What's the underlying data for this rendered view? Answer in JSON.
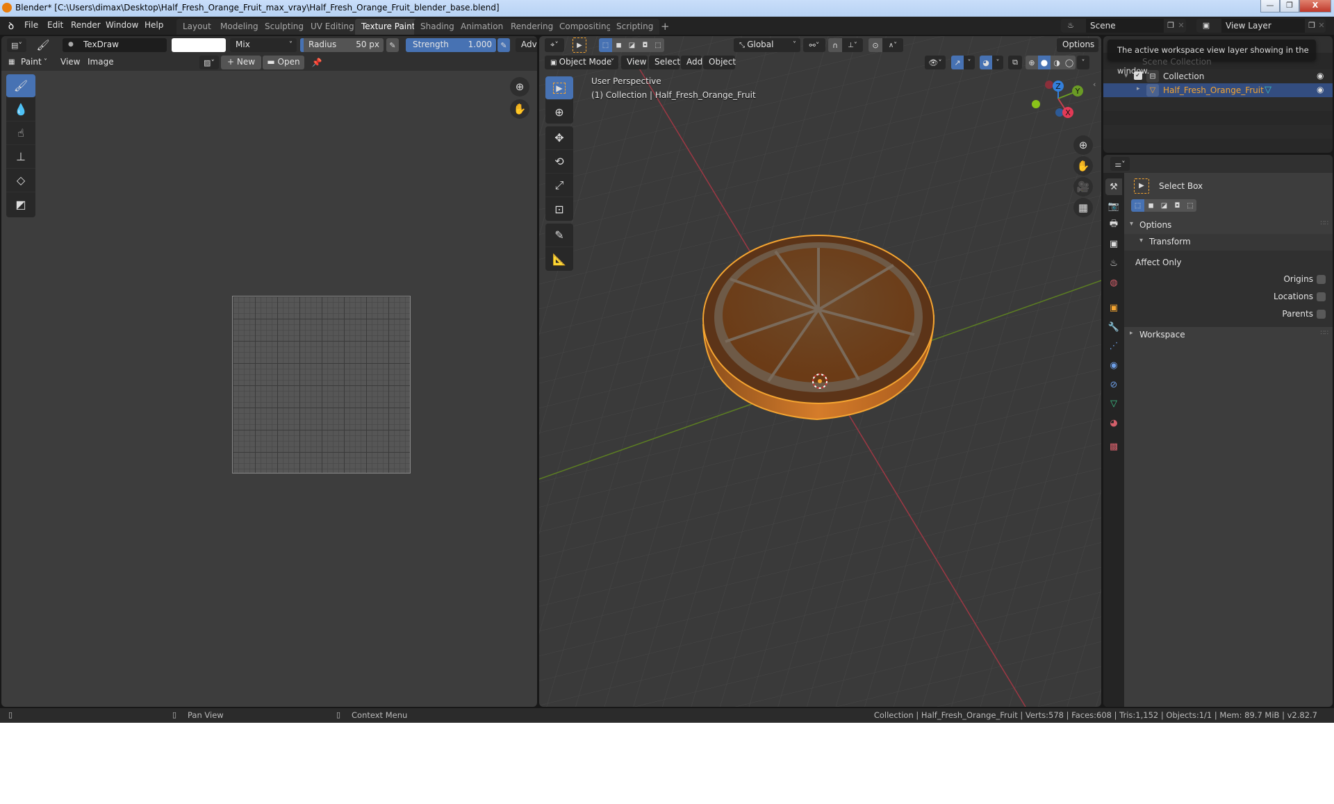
{
  "window": {
    "title": "Blender* [C:\\Users\\dimax\\Desktop\\Half_Fresh_Orange_Fruit_max_vray\\Half_Fresh_Orange_Fruit_blender_base.blend]",
    "minimize": "—",
    "maximize": "❐",
    "close": "X"
  },
  "menubar": {
    "items": [
      "File",
      "Edit",
      "Render",
      "Window",
      "Help"
    ]
  },
  "workspaces": {
    "tabs": [
      "Layout",
      "Modeling",
      "Sculpting",
      "UV Editing",
      "Texture Paint",
      "Shading",
      "Animation",
      "Rendering",
      "Compositing",
      "Scripting"
    ],
    "active": "Texture Paint",
    "add": "+"
  },
  "scene": {
    "name": "Scene"
  },
  "view_layer": {
    "name": "View Layer"
  },
  "tooltip": "The active workspace view layer showing in the window.",
  "image_editor": {
    "brush_name": "TexDraw",
    "blend_mode": "Mix",
    "radius_label": "Radius",
    "radius_value": "50 px",
    "strength_label": "Strength",
    "strength_value": "1.000",
    "advanced_label": "Adva",
    "mode": "Paint",
    "menu": [
      "View",
      "Image"
    ],
    "new_label": "New",
    "open_label": "Open",
    "brush_color": "#ffffff",
    "tools": [
      "draw",
      "soften",
      "smear",
      "clone",
      "fill",
      "mask"
    ]
  },
  "viewport": {
    "mode": "Object Mode",
    "menu": [
      "View",
      "Select",
      "Add",
      "Object"
    ],
    "orientation": "Global",
    "options_label": "Options",
    "overlay_title": "User Perspective",
    "overlay_subtitle": "(1) Collection | Half_Fresh_Orange_Fruit",
    "gizmo": {
      "x": "X",
      "y": "Y",
      "z": "Z"
    }
  },
  "outliner": {
    "rows": [
      {
        "label": "Scene Collection",
        "type": "scene"
      },
      {
        "label": "Collection",
        "type": "collection",
        "checked": true
      },
      {
        "label": "Half_Fresh_Orange_Fruit",
        "type": "mesh",
        "selected": true
      }
    ]
  },
  "properties": {
    "active_tool": "Select Box",
    "options_label": "Options",
    "transform_label": "Transform",
    "affect_only_label": "Affect Only",
    "checkboxes": [
      {
        "label": "Origins",
        "checked": false
      },
      {
        "label": "Locations",
        "checked": false
      },
      {
        "label": "Parents",
        "checked": false
      }
    ],
    "workspace_label": "Workspace"
  },
  "statusbar": {
    "left_hint": "",
    "middle_hint": "Pan View",
    "right_hint": "Context Menu",
    "stats": "Collection | Half_Fresh_Orange_Fruit | Verts:578 | Faces:608 | Tris:1,152 | Objects:1/1 | Mem: 89.7 MiB | v2.82.7"
  },
  "colors": {
    "accent": "#4772b3",
    "selection_outline": "#f5a531",
    "x_axis": "#c2404f",
    "y_axis": "#6a9b25",
    "z_axis": "#3380dc"
  }
}
